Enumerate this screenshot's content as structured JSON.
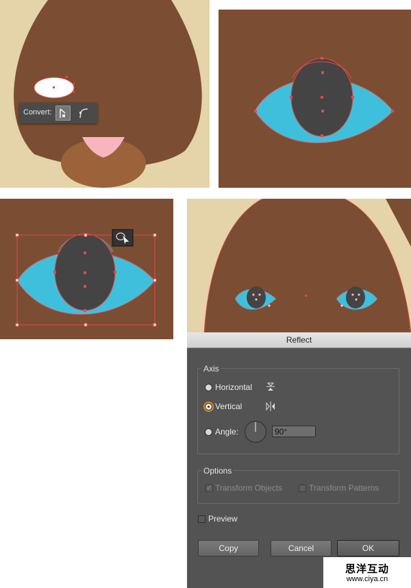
{
  "convert_toolbar": {
    "label": "Convert:",
    "buttons": [
      "corner-anchor-icon",
      "smooth-anchor-icon"
    ]
  },
  "colors": {
    "face_brown": "#7b4d33",
    "ear_cream": "#e5d3a9",
    "snout": "#9c6239",
    "nose_pink": "#f7b5bf",
    "eye_blue": "#3ec0dc",
    "pupil": "#444444",
    "anchor_red": "#e8474c"
  },
  "dialog": {
    "title": "Reflect",
    "axis": {
      "legend": "Axis",
      "horizontal_label": "Horizontal",
      "vertical_label": "Vertical",
      "angle_label": "Angle:",
      "angle_value": "90°",
      "selected": "vertical"
    },
    "options": {
      "legend": "Options",
      "transform_objects": "Transform Objects",
      "transform_patterns": "Transform Patterns"
    },
    "preview_label": "Preview",
    "buttons": {
      "copy": "Copy",
      "cancel": "Cancel",
      "ok": "OK"
    }
  },
  "watermark": {
    "title": "思洋互动",
    "url": "www.ciya.cn"
  }
}
